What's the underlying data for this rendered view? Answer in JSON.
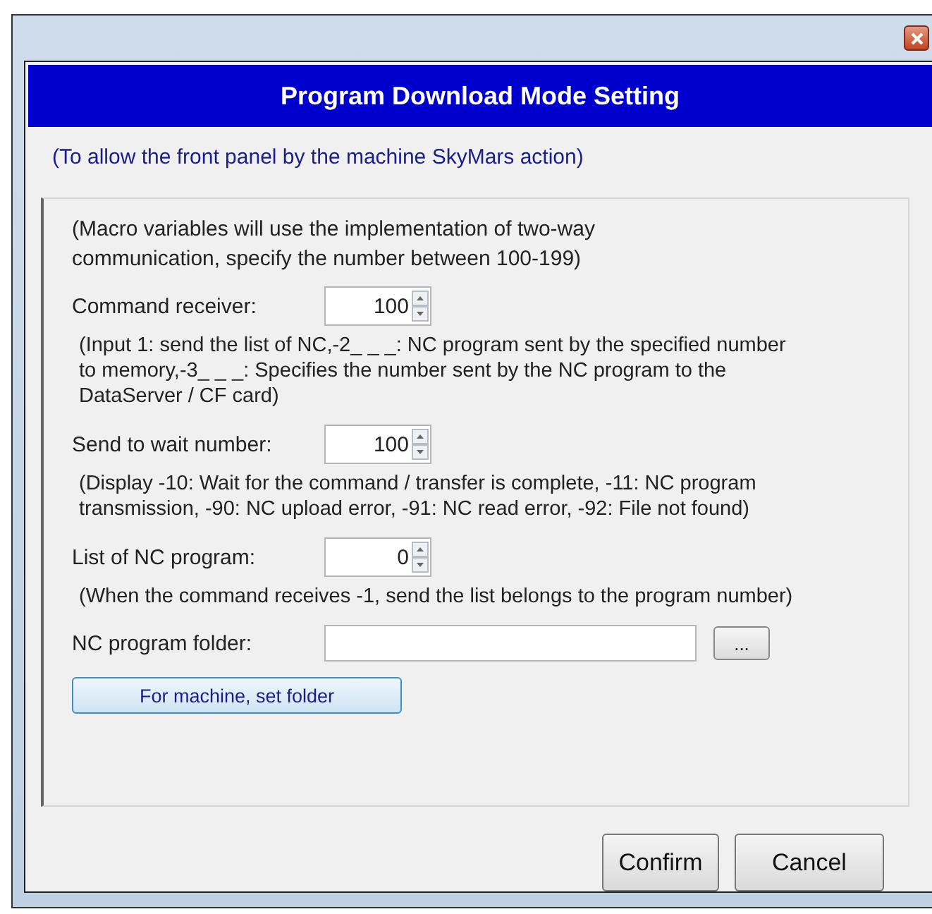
{
  "dialog": {
    "title": "Program Download Mode Setting",
    "subtitle": "(To allow the front panel by the machine SkyMars action)"
  },
  "group": {
    "note": "(Macro variables will use the implementation of two-way communication, specify the number between 100-199)",
    "fields": [
      {
        "kind": "spinner",
        "label": "Command receiver:",
        "value": "100",
        "hint": "(Input 1: send the list of NC,-2_ _ _: NC program sent by the specified number to memory,-3_ _ _: Specifies the number sent by the NC program to the DataServer / CF card)"
      },
      {
        "kind": "spinner",
        "label": "Send to wait number:",
        "value": "100",
        "hint": "(Display -10: Wait for the command / transfer is complete, -11: NC program transmission, -90: NC upload error, -91: NC read error, -92: File not found)"
      },
      {
        "kind": "spinner",
        "label": "List of NC program:",
        "value": "0",
        "hint": "(When the command receives -1, send the list belongs to the program number)"
      },
      {
        "kind": "folder",
        "label": "NC program folder:",
        "browse": "..."
      }
    ],
    "machine_button": "For machine, set folder"
  },
  "buttons": [
    "Confirm",
    "Cancel"
  ]
}
